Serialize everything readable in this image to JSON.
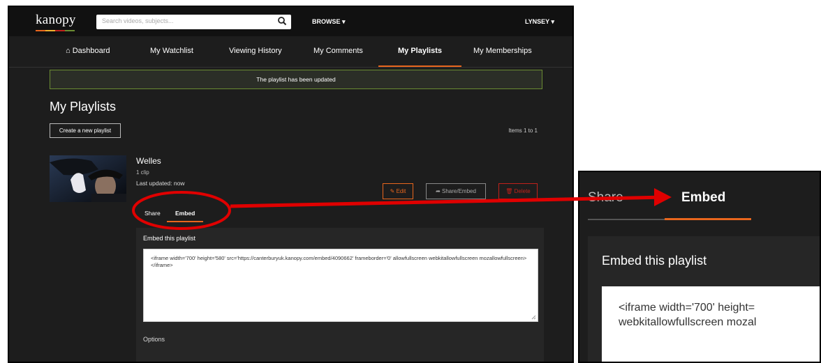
{
  "app": {
    "logo": "kanopy",
    "logo_colors": [
      "#e8661d",
      "#f2b22e",
      "#c0221b",
      "#6b8c32"
    ]
  },
  "header": {
    "search_placeholder": "Search videos, subjects...",
    "browse_label": "BROWSE ▾",
    "user_label": "LYNSEY ▾"
  },
  "nav": {
    "dashboard": "Dashboard",
    "watchlist": "My Watchlist",
    "history": "Viewing History",
    "comments": "My Comments",
    "playlists": "My Playlists",
    "memberships": "My Memberships"
  },
  "banner": "The playlist has been updated",
  "page": {
    "title": "My Playlists",
    "create_button": "Create a new playlist",
    "items_count": "Items 1 to 1"
  },
  "playlist": {
    "name": "Welles",
    "clips": "1 clip",
    "updated": "Last updated: now",
    "edit_label": "Edit",
    "share_label": "Share/Embed",
    "delete_label": "Delete"
  },
  "tabs": {
    "share": "Share",
    "embed": "Embed"
  },
  "embed": {
    "title": "Embed this playlist",
    "code": "<iframe width='700' height='580' src='https://canterburyuk.kanopy.com/embed/4090662' frameborder='0' allowfullscreen webkitallowfullscreen mozallowfullscreen></iframe>",
    "options_label": "Options"
  },
  "zoom": {
    "share_tab": "Share",
    "embed_tab": "Embed",
    "title": "Embed this playlist",
    "code_line1": "<iframe width='700' height=",
    "code_line2": "webkitallowfullscreen mozal"
  },
  "colors": {
    "accent": "#e8661d",
    "annotation": "#e00000",
    "success_border": "#6b8c32",
    "danger": "#c0221b"
  }
}
